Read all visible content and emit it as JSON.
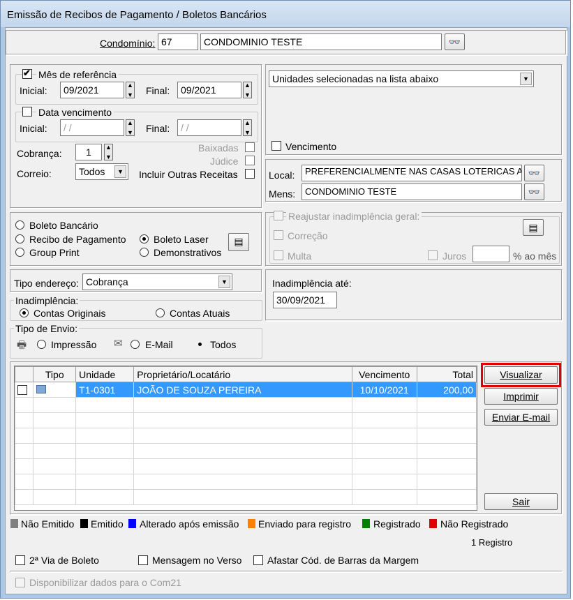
{
  "window": {
    "title": "Emissão de Recibos de Pagamento / Boletos Bancários"
  },
  "condominio": {
    "label": "Condomínio:",
    "code": "67",
    "name": "CONDOMINIO TESTE"
  },
  "mes_ref": {
    "label": "Mês de referência",
    "checked": true,
    "inicial_label": "Inicial:",
    "inicial": "09/2021",
    "final_label": "Final:",
    "final": "09/2021"
  },
  "data_venc": {
    "label": "Data vencimento",
    "checked": false,
    "inicial_label": "Inicial:",
    "inicial": "/ /",
    "final_label": "Final:",
    "final": "/ /"
  },
  "cobranca": {
    "label": "Cobrança:",
    "value": "1"
  },
  "correio": {
    "label": "Correio:",
    "value": "Todos"
  },
  "flags": {
    "baixadas": "Baixadas",
    "judice": "Júdice",
    "outras": "Incluir Outras Receitas"
  },
  "unidades": {
    "select": "Unidades selecionadas na lista abaixo",
    "vencimento": "Vencimento"
  },
  "local": {
    "label": "Local:",
    "value": "PREFERENCIALMENTE NAS CASAS LOTERICAS ATÉ O VALOR LIMITE"
  },
  "mens": {
    "label": "Mens:",
    "value": "CONDOMINIO TESTE"
  },
  "tipo_doc": {
    "boleto_bancario": "Boleto Bancário",
    "recibo": "Recibo de Pagamento",
    "boleto_laser": "Boleto Laser",
    "group_print": "Group Print",
    "demonstrativos": "Demonstrativos"
  },
  "reajuste": {
    "label": "Reajustar inadimplência geral:",
    "correcao": "Correção",
    "multa": "Multa",
    "juros": "Juros",
    "ao_mes": "% ao mês"
  },
  "tipo_endereco": {
    "label": "Tipo endereço:",
    "value": "Cobrança"
  },
  "inadimplencia_ate": {
    "label": "Inadimplência até:",
    "value": "30/09/2021"
  },
  "inadimplencia": {
    "label": "Inadimplência:",
    "originais": "Contas Originais",
    "atuais": "Contas Atuais"
  },
  "envio": {
    "label": "Tipo de Envio:",
    "impressao": "Impressão",
    "email": "E-Mail",
    "todos": "Todos"
  },
  "table": {
    "headers": [
      "Tipo",
      "Unidade",
      "Proprietário/Locatário",
      "Vencimento",
      "Total"
    ],
    "rows": [
      {
        "checked": true,
        "tipo": "",
        "unidade": "T1-0301",
        "proprietario": "JOÃO DE SOUZA PEREIRA",
        "vencimento": "10/10/2021",
        "total": "200,00"
      }
    ]
  },
  "buttons": {
    "visualizar": "Visualizar",
    "imprimir": "Imprimir",
    "enviar": "Enviar E-mail",
    "sair": "Sair"
  },
  "legend": [
    {
      "label": "Não Emitido",
      "color": "#808080"
    },
    {
      "label": "Emitido",
      "color": "#000000"
    },
    {
      "label": "Alterado após emissão",
      "color": "#0000ff"
    },
    {
      "label": "Enviado para registro",
      "color": "#ff8000"
    },
    {
      "label": "Registrado",
      "color": "#008000"
    },
    {
      "label": "Não Registrado",
      "color": "#e00000"
    }
  ],
  "count": "1 Registro",
  "options": {
    "segunda_via": "2ª Via de Boleto",
    "mensagem_verso": "Mensagem no Verso",
    "afastar": "Afastar Cód. de Barras da Margem",
    "com21": "Disponibilizar dados para o Com21"
  }
}
